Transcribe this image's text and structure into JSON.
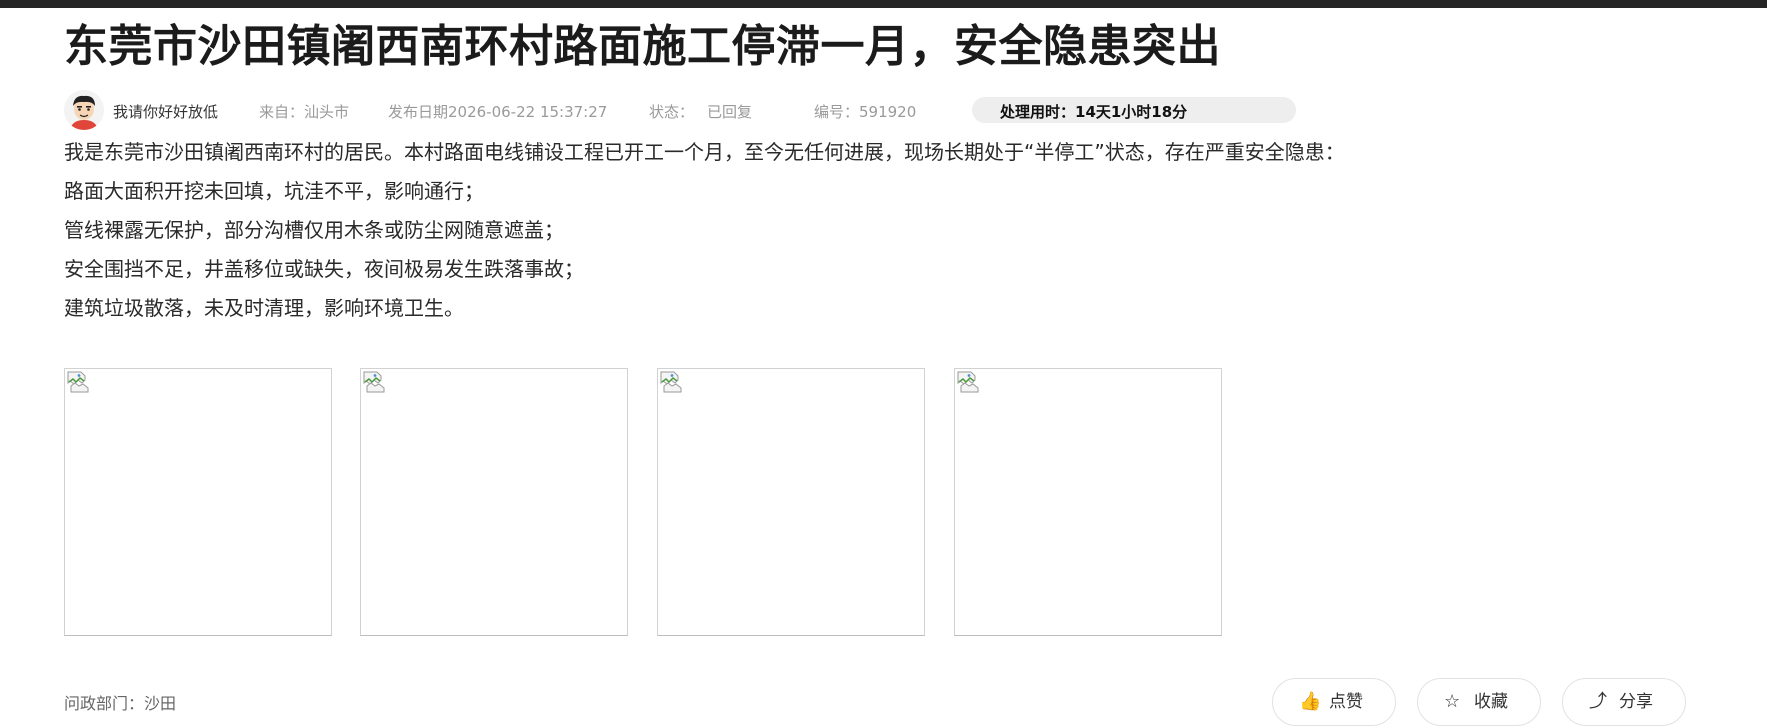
{
  "article": {
    "title": "东莞市沙田镇阇西南环村路面施工停滞一月，安全隐患突出",
    "author": "我请你好好放低",
    "source": "来自：汕头市",
    "publish_date": "发布日期2026-06-22 15:37:27",
    "status_label": "状态：",
    "status_value": "已回复",
    "id_label": "编号：591920",
    "processing_time": "处理用时：14天1小时18分",
    "paragraphs": [
      "我是东莞市沙田镇阇西南环村的居民。本村路面电线铺设工程已开工一个月，至今无任何进展，现场长期处于“半停工”状态，存在严重安全隐患：",
      "路面大面积开挖未回填，坑洼不平，影响通行；",
      "管线裸露无保护，部分沟槽仅用木条或防尘网随意遮盖；",
      "安全围挡不足，井盖移位或缺失，夜间极易发生跌落事故；",
      "建筑垃圾散落，未及时清理，影响环境卫生。"
    ],
    "department": "问政部门：沙田"
  },
  "actions": {
    "like": "点赞",
    "favorite": "收藏",
    "share": "分享"
  },
  "icons": {
    "avatar": "avatar-cartoon-face",
    "like": "thumbs-up-icon",
    "favorite": "star-icon",
    "share": "share-icon",
    "broken_image": "broken-image-icon"
  },
  "colors": {
    "top_bar": "#262626",
    "badge_bg": "#eeeeee",
    "meta_gray": "#9a9a9a"
  }
}
